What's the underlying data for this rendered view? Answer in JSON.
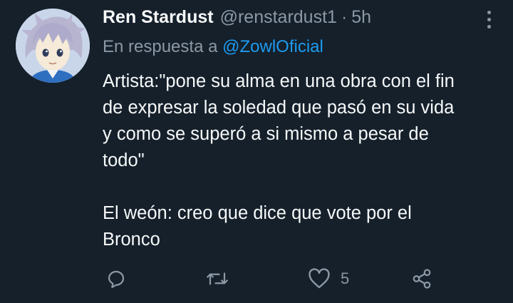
{
  "tweet": {
    "author_name": "Ren Stardust",
    "author_handle": "@renstardust1",
    "separator": "·",
    "time": "5h",
    "reply_prefix": "En respuesta a",
    "reply_mention": "@ZowlOficial",
    "text_lines": [
      "Artista:\"pone su alma en una obra con el fin",
      "de expresar la soledad que pasó en su vida",
      "y como se superó a si mismo a pesar de",
      "todo\"",
      "El weón: creo que dice que vote por el",
      "Bronco"
    ]
  },
  "actions": {
    "reply_icon": "speech-bubble-icon",
    "retweet_icon": "retweet-arrows-icon",
    "like_icon": "heart-icon",
    "like_count": "5",
    "share_icon": "share-icon"
  },
  "colors": {
    "background": "#15202b",
    "primary_text": "#f7f9f9",
    "secondary_text": "#8b98a5",
    "accent": "#1d9bf0"
  }
}
